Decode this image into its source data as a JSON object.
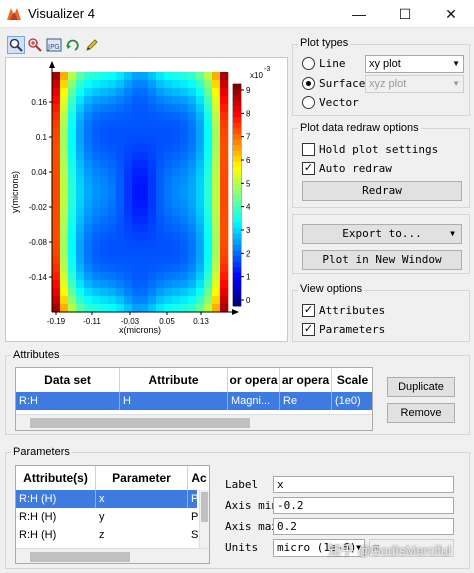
{
  "window": {
    "title": "Visualizer 4",
    "minimize": "—",
    "maximize": "☐",
    "close": "✕"
  },
  "toolbar": [
    "zoom-icon",
    "pan-icon",
    "export-jpg-icon",
    "rotate-icon",
    "pencil-icon"
  ],
  "plot": {
    "type": "heatmap",
    "xlabel": "x(microns)",
    "ylabel": "y(microns)",
    "xticks": [
      "-0.19",
      "-0.11",
      "-0.03",
      "0.05",
      "0.13"
    ],
    "yticks": [
      "0.16",
      "0.1",
      "0.04",
      "-0.02",
      "-0.08",
      "-0.14"
    ],
    "colorbar_scale": "x10",
    "colorbar_exp": "-3",
    "colorbar_ticks": [
      "9",
      "8",
      "7",
      "6",
      "5",
      "4",
      "3",
      "2",
      "1",
      "0"
    ]
  },
  "plot_types": {
    "title": "Plot types",
    "line": "Line",
    "surface": "Surface",
    "vector": "Vector",
    "selected": "surface",
    "line_combo": "xy plot",
    "surface_combo": "xyz plot"
  },
  "redraw_options": {
    "title": "Plot data redraw options",
    "hold": "Hold plot settings",
    "hold_checked": false,
    "auto": "Auto redraw",
    "auto_checked": true,
    "redraw_button": "Redraw"
  },
  "export": {
    "export_button": "Export to...",
    "new_window_button": "Plot in New Window"
  },
  "view_options": {
    "title": "View options",
    "attributes": "Attributes",
    "attributes_checked": true,
    "parameters": "Parameters",
    "parameters_checked": true
  },
  "attributes": {
    "title": "Attributes",
    "columns": [
      "Data set",
      "Attribute",
      "or opera",
      "ar opera",
      "Scale"
    ],
    "rows": [
      [
        "R:H",
        "H",
        "Magni...",
        "Re",
        "(1e0)"
      ]
    ],
    "duplicate_button": "Duplicate",
    "remove_button": "Remove"
  },
  "parameters": {
    "title": "Parameters",
    "columns": [
      "Attribute(s)",
      "Parameter",
      "Ac"
    ],
    "rows": [
      [
        "R:H (H)",
        "x",
        "Plo"
      ],
      [
        "R:H (H)",
        "y",
        "Plo"
      ],
      [
        "R:H (H)",
        "z",
        "Slic"
      ]
    ],
    "label_label": "Label",
    "label_value": "x",
    "axis_min_label": "Axis min",
    "axis_min_value": "-0.2",
    "axis_max_label": "Axis max",
    "axis_max_value": "0.2",
    "units_label": "Units",
    "units_value": "micro (1e-6)",
    "units_value2": "m"
  },
  "watermark": "知乎 @GodIsMerciful"
}
